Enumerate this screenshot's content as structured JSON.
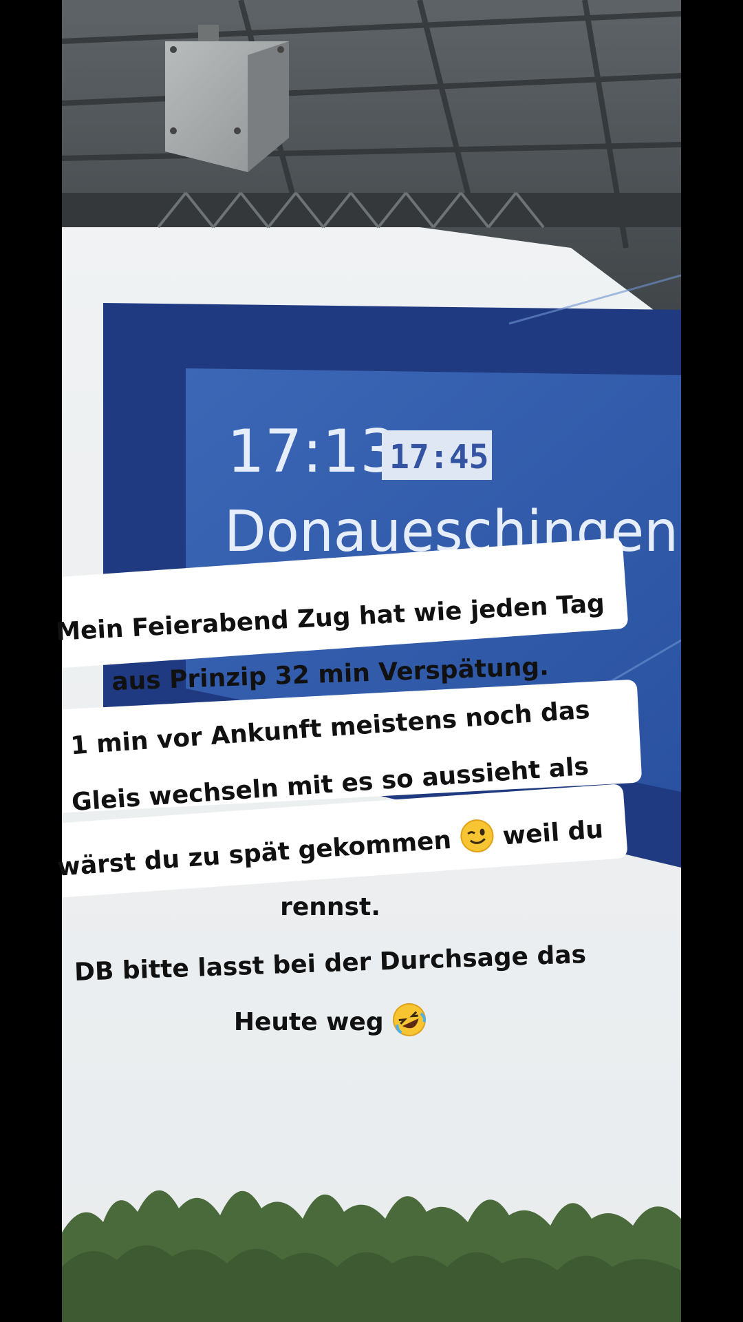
{
  "board": {
    "scheduled_time": "17:13",
    "actual_time": "17:45",
    "destination": "Donaueschingen"
  },
  "caption": {
    "lines": [
      "Mein Feierabend Zug hat wie jeden Tag",
      "aus Prinzip 32 min Verspätung.",
      "1 min vor Ankunft meistens noch das",
      "Gleis wechseln mit es so aussieht als",
      "wärst du zu spät gekommen",
      "weil du",
      "rennst.",
      "DB bitte lasst bei der Durchsage das",
      "Heute weg"
    ],
    "emoji_wink": "winking-face",
    "emoji_laugh": "rolling-on-the-floor-laughing"
  },
  "colors": {
    "board_blue": "#2f5aa8",
    "board_frame": "#233e86",
    "caption_bg": "#ffffff",
    "caption_text": "#111111",
    "side_bars": "#000000"
  }
}
